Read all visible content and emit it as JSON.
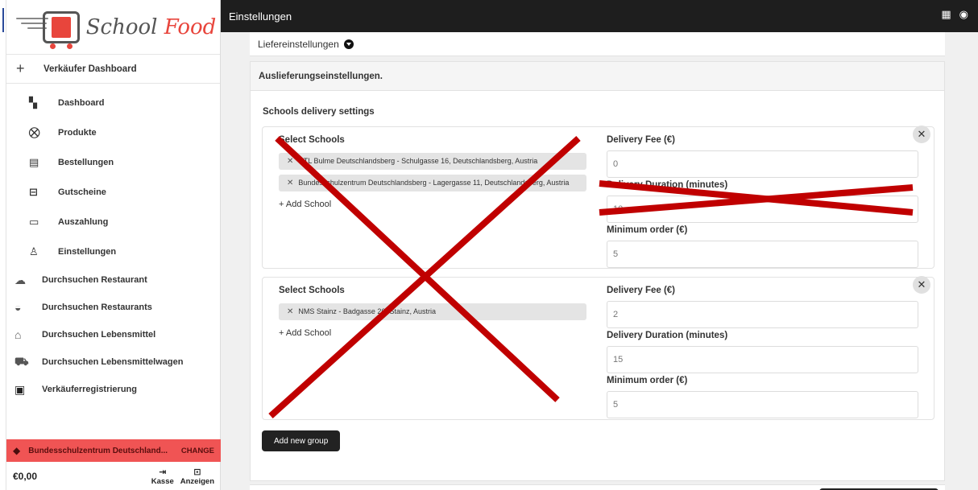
{
  "logo": {
    "text_school": "School",
    "text_food": "Food"
  },
  "sidebar": {
    "header_icon": "+",
    "header_label": "Verkäufer Dashboard",
    "items": [
      {
        "label": "Dashboard",
        "icon": "grid-icon"
      },
      {
        "label": "Produkte",
        "icon": "basket-icon"
      },
      {
        "label": "Bestellungen",
        "icon": "document-icon"
      },
      {
        "label": "Gutscheine",
        "icon": "gift-icon"
      },
      {
        "label": "Auszahlung",
        "icon": "card-icon"
      },
      {
        "label": "Einstellungen",
        "icon": "user-icon"
      }
    ],
    "browse": [
      {
        "label": "Durchsuchen Restaurant",
        "icon": "chef-hat-icon"
      },
      {
        "label": "Durchsuchen Restaurants",
        "icon": "burger-icon"
      },
      {
        "label": "Durchsuchen Lebensmittel",
        "icon": "grocery-icon"
      },
      {
        "label": "Durchsuchen Lebensmittelwagen",
        "icon": "food-truck-icon"
      },
      {
        "label": "Verkäuferregistrierung",
        "icon": "clipboard-icon"
      }
    ],
    "school_bar": {
      "name": "Bundesschulzentrum Deutschland...",
      "change": "CHANGE"
    },
    "bottom": {
      "amount": "€0,00",
      "checkout": "Kasse",
      "view": "Anzeigen"
    }
  },
  "topbar": {
    "title": "Einstellungen"
  },
  "main": {
    "liefer_label": "Liefereinstellungen",
    "section_header": "Auslieferungseinstellungen.",
    "section_title": "Schools delivery settings",
    "labels": {
      "select_schools": "Select Schools",
      "add_school": "+ Add School",
      "fee": "Delivery Fee (€)",
      "duration": "Delivery Duration (minutes)",
      "minimum": "Minimum order (€)"
    },
    "groups": [
      {
        "schools": [
          "HTL Bulme Deutschlandsberg - Schulgasse 16, Deutschlandsberg, Austria",
          "Bundesschulzentrum Deutschlandsberg - Lagergasse 11, Deutschlandsberg, Austria"
        ],
        "fee": "0",
        "duration": "10",
        "minimum": "5"
      },
      {
        "schools": [
          "NMS Stainz - Badgasse 20, Stainz, Austria"
        ],
        "fee": "2",
        "duration": "15",
        "minimum": "5"
      }
    ],
    "add_group": "Add new group"
  },
  "colors": {
    "accent_red": "#f05454",
    "cross_red": "#c00000",
    "topbar": "#1e1e1e"
  }
}
